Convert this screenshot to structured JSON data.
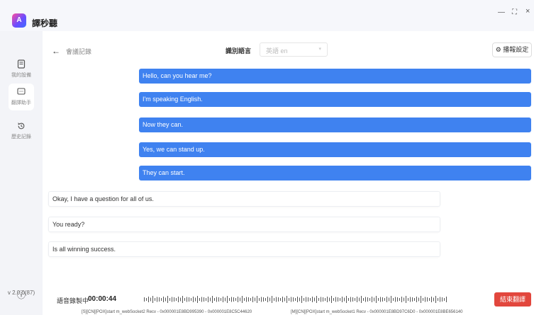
{
  "app": {
    "title": "譯秒聽",
    "logo_text": "A",
    "controls": {
      "minimize": "—",
      "maximize": "⛶",
      "close": "×"
    }
  },
  "sidebar": {
    "items": [
      {
        "label": "我的設備",
        "icon": "device-icon"
      },
      {
        "label": "翻譯助手",
        "icon": "chat-icon"
      },
      {
        "label": "歷史記錄",
        "icon": "history-icon"
      }
    ],
    "version_icon": "ⓘ",
    "version": "v 2.0.0(87)"
  },
  "header": {
    "back": "←",
    "breadcrumb": "會議記錄",
    "lang_label": "識別語言",
    "lang_placeholder": "英語 en",
    "settings_label": "播報設定"
  },
  "messages": {
    "me": [
      "Hello, can you hear me?",
      "I'm speaking English.",
      "Now they can.",
      "Yes, we can stand up.",
      "They can start."
    ],
    "other": [
      "Okay, I have a question for all of us.",
      "You ready?",
      "Is all winning success."
    ]
  },
  "footer": {
    "rec_label": "語音錄製中",
    "rec_time": "00:00:44",
    "end_button": "結束翻譯",
    "log_left": "[S][CN][POX]start m_webSocket2 Recv - 0x000001E8BD995390 - 0x000001E8C5C44620",
    "log_right": "[M][CN][POX]start m_webSocket1 Recv - 0x000001E8BD97C6D0 - 0x000001E8BE656140"
  },
  "colors": {
    "accent": "#3f82f0",
    "danger": "#e2473d"
  }
}
